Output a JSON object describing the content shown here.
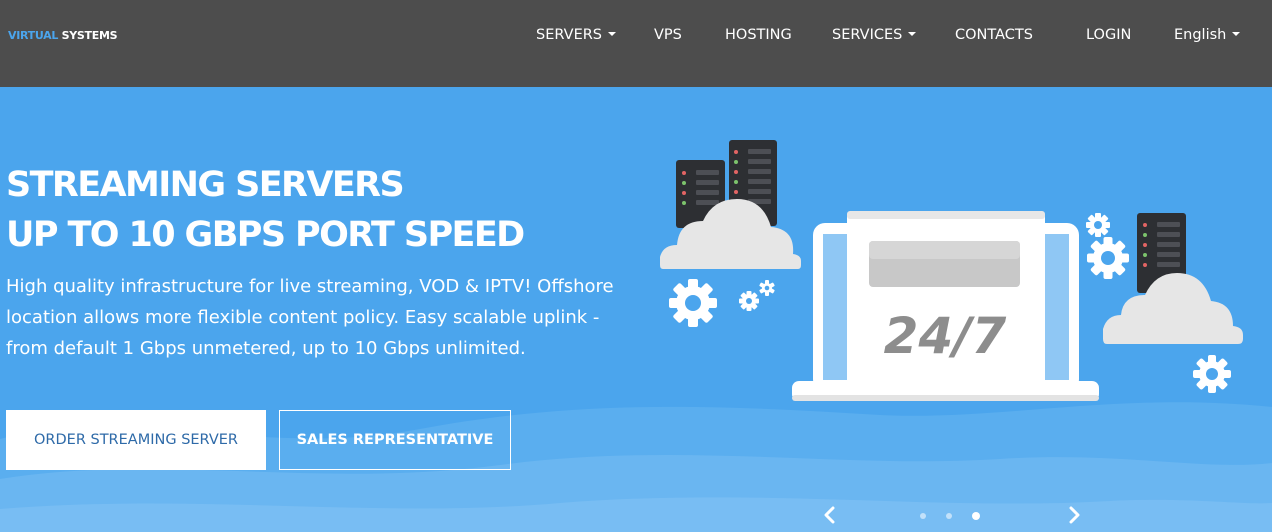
{
  "brand": {
    "name_part1": "VIRTUAL",
    "name_part2": "SYSTEMS"
  },
  "nav": {
    "servers": "SERVERS",
    "vps": "VPS",
    "hosting": "HOSTING",
    "services": "SERVICES",
    "contacts": "CONTACTS",
    "login": "LOGIN",
    "language": "English"
  },
  "hero": {
    "headline_line1": "STREAMING SERVERS",
    "headline_line2": "UP TO 10 GBPS PORT SPEED",
    "description": "High quality infrastructure for live streaming, VOD & IPTV! Offshore location allows more flexible content policy. Easy scalable uplink - from default 1 Gbps unmetered, up to 10 Gbps unlimited.",
    "btn_order": "ORDER STREAMING SERVER",
    "btn_sales": "SALES REPRESENTATIVE",
    "illustration_text": "24/7"
  },
  "carousel": {
    "slide_count": 3,
    "active_index": 3
  },
  "colors": {
    "navbar": "#4d4d4d",
    "hero_bg": "#4ba5ed",
    "accent": "#4ba5ed",
    "button_text": "#2e6aa8"
  },
  "icons": [
    "chevron-left-icon",
    "chevron-right-icon",
    "caret-down-icon",
    "server-rack-icon",
    "cloud-icon",
    "gear-icon",
    "laptop-icon"
  ]
}
